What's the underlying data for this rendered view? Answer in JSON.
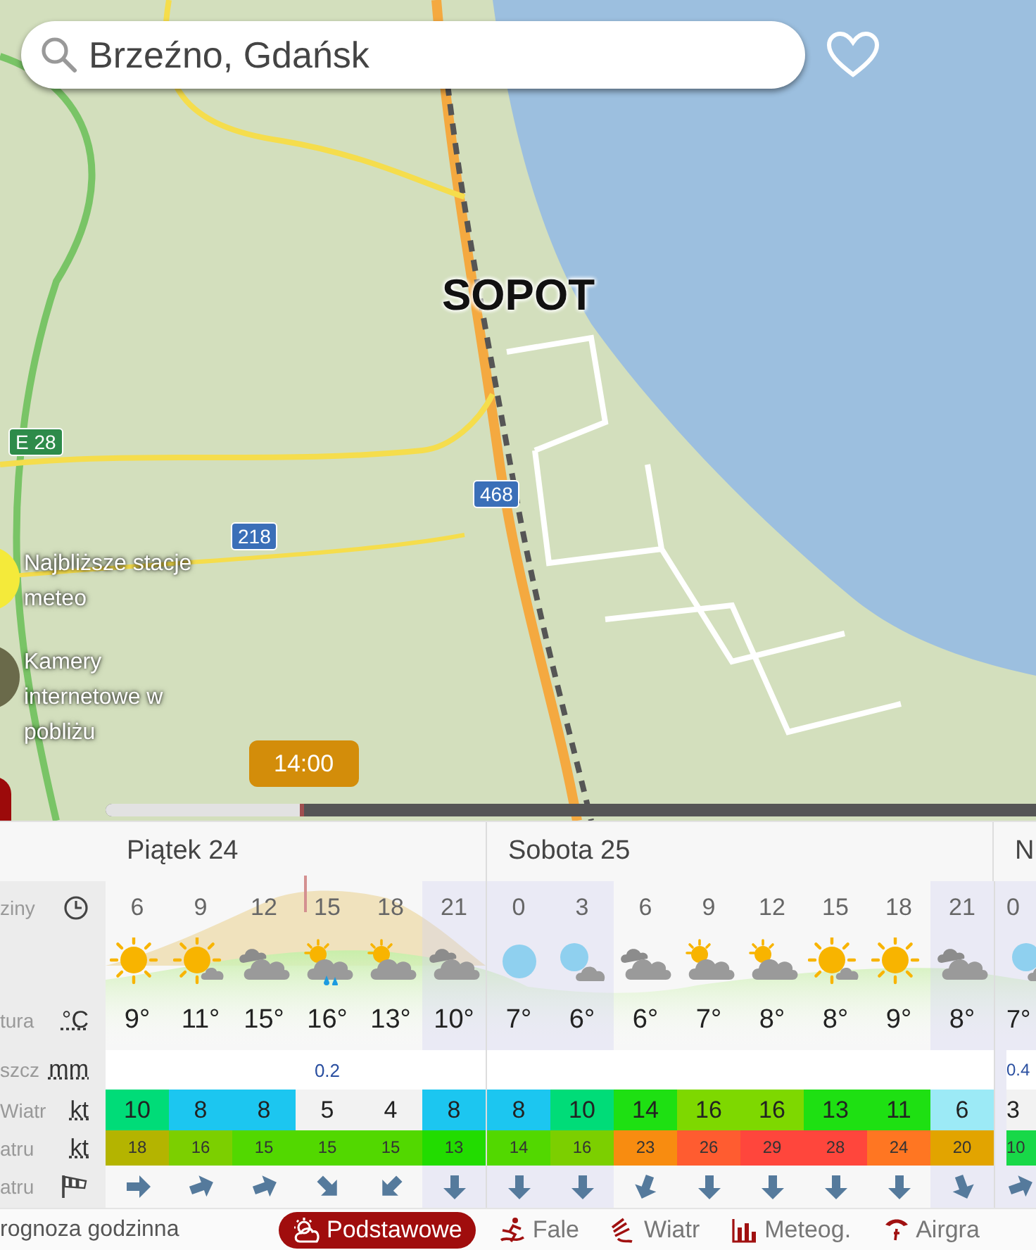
{
  "search": {
    "value": "Brzeźno, Gdańsk"
  },
  "map": {
    "city_label": "SOPOT",
    "road_badges": [
      {
        "text": "E 28",
        "kind": "euro"
      },
      {
        "text": "468",
        "kind": "national"
      },
      {
        "text": "218",
        "kind": "national"
      }
    ]
  },
  "side_links": [
    {
      "label": "Najbliższe stacje meteo",
      "kind": "stations"
    },
    {
      "label": "Kamery internetowe w pobliżu",
      "kind": "cameras"
    }
  ],
  "timeline": {
    "time": "14:00",
    "level": 0.213
  },
  "legend": [
    {
      "kind": "hours",
      "label": "ziny"
    },
    {
      "kind": "icons"
    },
    {
      "kind": "temp",
      "label": "tura",
      "unit": "°C"
    },
    {
      "kind": "rain",
      "label": "szcz",
      "unit": "mm"
    },
    {
      "kind": "wind",
      "label": "Wiatr",
      "unit": "kt"
    },
    {
      "kind": "gust",
      "label": "atru",
      "unit": "kt"
    },
    {
      "kind": "direction",
      "label": "atru"
    }
  ],
  "days": [
    {
      "label": "Piątek 24",
      "hours": [
        {
          "hour": "6",
          "night": false,
          "kind": "sun",
          "temp": "9°",
          "wind": "10",
          "gust": "18",
          "arrow": {
            "kind": "east"
          }
        },
        {
          "hour": "9",
          "night": false,
          "kind": "sunny",
          "temp": "11°",
          "wind": "8",
          "gust": "16",
          "arrow": {
            "kind": "eastnortheast"
          }
        },
        {
          "hour": "12",
          "night": false,
          "kind": "clouds",
          "temp": "15°",
          "wind": "8",
          "gust": "15",
          "arrow": {
            "kind": "eastnortheast"
          }
        },
        {
          "hour": "15",
          "night": false,
          "kind": "showers",
          "temp": "16°",
          "rain": "0.2",
          "wind": "5",
          "gust": "15",
          "arrow": {
            "kind": "southeast"
          }
        },
        {
          "hour": "18",
          "night": false,
          "kind": "partly",
          "temp": "13°",
          "wind": "4",
          "gust": "15",
          "arrow": {
            "kind": "southwest"
          }
        },
        {
          "hour": "21",
          "night": true,
          "kind": "clouds",
          "temp": "10°",
          "wind": "8",
          "gust": "13",
          "arrow": {
            "kind": "south"
          }
        }
      ]
    },
    {
      "label": "Sobota 25",
      "hours": [
        {
          "hour": "0",
          "night": true,
          "kind": "moon",
          "temp": "7°",
          "wind": "8",
          "gust": "14",
          "arrow": {
            "kind": "south"
          }
        },
        {
          "hour": "3",
          "night": true,
          "kind": "mooncloud",
          "temp": "6°",
          "wind": "10",
          "gust": "16",
          "arrow": {
            "kind": "south"
          }
        },
        {
          "hour": "6",
          "night": false,
          "kind": "clouds",
          "temp": "6°",
          "wind": "14",
          "gust": "23",
          "arrow": {
            "kind": "southsouthwest"
          }
        },
        {
          "hour": "9",
          "night": false,
          "kind": "partly",
          "temp": "7°",
          "wind": "16",
          "gust": "26",
          "arrow": {
            "kind": "south"
          }
        },
        {
          "hour": "12",
          "night": false,
          "kind": "partly",
          "temp": "8°",
          "wind": "16",
          "gust": "29",
          "arrow": {
            "kind": "south"
          }
        },
        {
          "hour": "15",
          "night": false,
          "kind": "sunny",
          "temp": "8°",
          "wind": "13",
          "gust": "28",
          "arrow": {
            "kind": "south"
          }
        },
        {
          "hour": "18",
          "night": false,
          "kind": "sun",
          "temp": "9°",
          "wind": "11",
          "gust": "24",
          "arrow": {
            "kind": "south"
          }
        },
        {
          "hour": "21",
          "night": true,
          "kind": "clouds",
          "temp": "8°",
          "wind": "6",
          "gust": "20",
          "arrow": {
            "kind": "southsoutheast"
          }
        }
      ]
    },
    {
      "label": "N",
      "hours": [
        {
          "hour": "0",
          "night": true,
          "kind": "moonrain",
          "temp": "7°",
          "rain": "0.4",
          "wind": "3",
          "gust": "10",
          "arrow": {
            "kind": "eastnortheast"
          }
        }
      ]
    }
  ],
  "section_title": "rognoza godzinna",
  "bottom_tabs": [
    {
      "label": "Podstawowe",
      "kind": "basic",
      "selected": true
    },
    {
      "label": "Fale",
      "kind": "waves",
      "selected": false
    },
    {
      "label": "Wiatr",
      "kind": "wind",
      "selected": false
    },
    {
      "label": "Meteog.",
      "kind": "chart",
      "selected": false
    },
    {
      "label": "Airgra",
      "kind": "paraglider",
      "selected": false
    }
  ]
}
